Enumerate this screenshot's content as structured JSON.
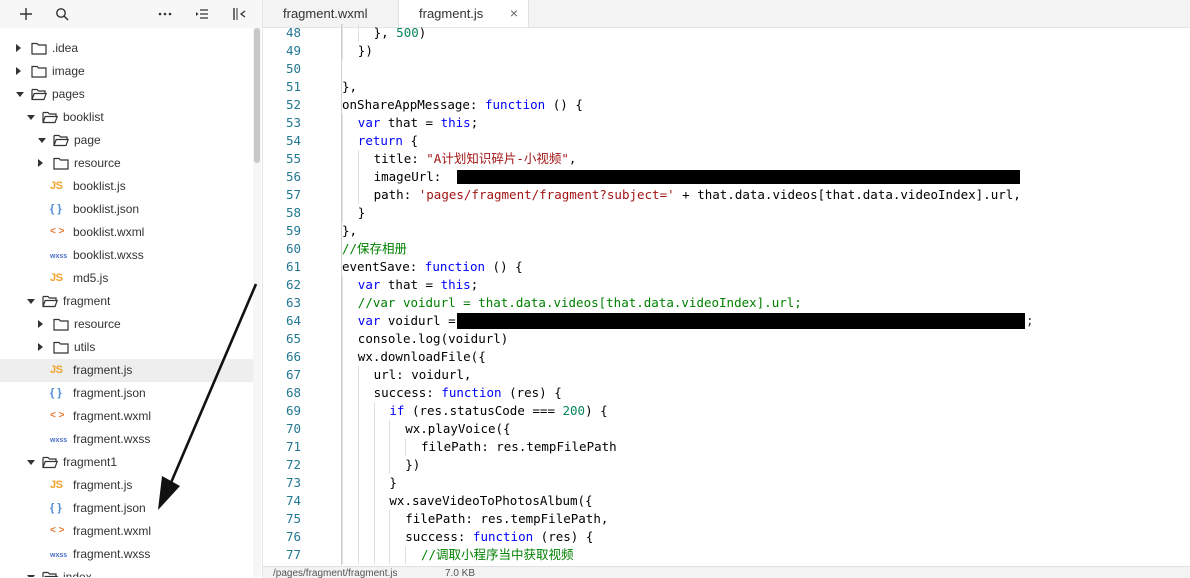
{
  "explorer": {
    "toolbar": {
      "icons": [
        "plus-icon",
        "search-icon",
        "more-icon",
        "outdent-icon",
        "collapse-icon"
      ]
    },
    "tree": [
      {
        "label": ".idea",
        "kind": "folder",
        "depth": 0,
        "expanded": false
      },
      {
        "label": "image",
        "kind": "folder",
        "depth": 0,
        "expanded": false
      },
      {
        "label": "pages",
        "kind": "folder",
        "depth": 0,
        "expanded": true
      },
      {
        "label": "booklist",
        "kind": "folder",
        "depth": 1,
        "expanded": true
      },
      {
        "label": "page",
        "kind": "folder",
        "depth": 2,
        "expanded": true
      },
      {
        "label": "resource",
        "kind": "folder",
        "depth": 2,
        "expanded": false
      },
      {
        "label": "booklist.js",
        "kind": "js",
        "depth": 2
      },
      {
        "label": "booklist.json",
        "kind": "json",
        "depth": 2
      },
      {
        "label": "booklist.wxml",
        "kind": "wxml",
        "depth": 2
      },
      {
        "label": "booklist.wxss",
        "kind": "wxss",
        "depth": 2
      },
      {
        "label": "md5.js",
        "kind": "js",
        "depth": 2
      },
      {
        "label": "fragment",
        "kind": "folder",
        "depth": 1,
        "expanded": true
      },
      {
        "label": "resource",
        "kind": "folder",
        "depth": 2,
        "expanded": false
      },
      {
        "label": "utils",
        "kind": "folder",
        "depth": 2,
        "expanded": false
      },
      {
        "label": "fragment.js",
        "kind": "js",
        "depth": 2,
        "selected": true
      },
      {
        "label": "fragment.json",
        "kind": "json",
        "depth": 2
      },
      {
        "label": "fragment.wxml",
        "kind": "wxml",
        "depth": 2
      },
      {
        "label": "fragment.wxss",
        "kind": "wxss",
        "depth": 2
      },
      {
        "label": "fragment1",
        "kind": "folder",
        "depth": 1,
        "expanded": true
      },
      {
        "label": "fragment.js",
        "kind": "js",
        "depth": 2
      },
      {
        "label": "fragment.json",
        "kind": "json",
        "depth": 2
      },
      {
        "label": "fragment.wxml",
        "kind": "wxml",
        "depth": 2
      },
      {
        "label": "fragment.wxss",
        "kind": "wxss",
        "depth": 2
      },
      {
        "label": "index",
        "kind": "folder",
        "depth": 1,
        "expanded": true
      }
    ],
    "type_badges": {
      "js": "JS",
      "json": "{ }",
      "wxml": "< >",
      "wxss": "wxss"
    }
  },
  "editor": {
    "tabs": [
      {
        "label": "fragment.wxml",
        "active": false
      },
      {
        "label": "fragment.js",
        "active": true,
        "close": "×"
      }
    ],
    "lines": [
      {
        "n": "48",
        "indent": 2,
        "tokens": [
          [
            "p",
            "}, "
          ],
          [
            "num",
            "500"
          ],
          [
            "p",
            ")"
          ]
        ]
      },
      {
        "n": "49",
        "indent": 1,
        "tokens": [
          [
            "p",
            "})"
          ]
        ]
      },
      {
        "n": "50",
        "indent": 0,
        "tokens": []
      },
      {
        "n": "51",
        "indent": 0,
        "tokens": [
          [
            "p",
            "},"
          ]
        ]
      },
      {
        "n": "52",
        "indent": 0,
        "tokens": [
          [
            "p",
            "onShareAppMessage: "
          ],
          [
            "kw",
            "function"
          ],
          [
            "p",
            " () {"
          ]
        ]
      },
      {
        "n": "53",
        "indent": 1,
        "tokens": [
          [
            "kw",
            "var"
          ],
          [
            "p",
            " that = "
          ],
          [
            "kw",
            "this"
          ],
          [
            "p",
            ";"
          ]
        ]
      },
      {
        "n": "54",
        "indent": 1,
        "tokens": [
          [
            "kw",
            "return"
          ],
          [
            "p",
            " {"
          ]
        ]
      },
      {
        "n": "55",
        "indent": 2,
        "tokens": [
          [
            "p",
            "title: "
          ],
          [
            "str",
            "\"A计划知识碎片-小视频\""
          ],
          [
            "p",
            ","
          ]
        ]
      },
      {
        "n": "56",
        "indent": 2,
        "tokens": [
          [
            "p",
            "imageUrl:"
          ]
        ]
      },
      {
        "n": "57",
        "indent": 2,
        "tokens": [
          [
            "p",
            "path: "
          ],
          [
            "str",
            "'pages/fragment/fragment?subject='"
          ],
          [
            "p",
            " + that.data.videos[that.data.videoIndex].url,"
          ]
        ]
      },
      {
        "n": "58",
        "indent": 1,
        "tokens": [
          [
            "p",
            "}"
          ]
        ]
      },
      {
        "n": "59",
        "indent": 0,
        "tokens": [
          [
            "p",
            "},"
          ]
        ]
      },
      {
        "n": "60",
        "indent": 0,
        "tokens": [
          [
            "cm",
            "//保存相册"
          ]
        ]
      },
      {
        "n": "61",
        "indent": 0,
        "tokens": [
          [
            "p",
            "eventSave: "
          ],
          [
            "kw",
            "function"
          ],
          [
            "p",
            " () {"
          ]
        ]
      },
      {
        "n": "62",
        "indent": 1,
        "tokens": [
          [
            "kw",
            "var"
          ],
          [
            "p",
            " that = "
          ],
          [
            "kw",
            "this"
          ],
          [
            "p",
            ";"
          ]
        ]
      },
      {
        "n": "63",
        "indent": 1,
        "tokens": [
          [
            "cm",
            "//var voidurl = that.data.videos[that.data.videoIndex].url;"
          ]
        ]
      },
      {
        "n": "64",
        "indent": 1,
        "tokens": [
          [
            "kw",
            "var"
          ],
          [
            "p",
            " voidurl ="
          ]
        ]
      },
      {
        "n": "65",
        "indent": 1,
        "tokens": [
          [
            "p",
            "console.log(voidurl)"
          ]
        ]
      },
      {
        "n": "66",
        "indent": 1,
        "tokens": [
          [
            "p",
            "wx.downloadFile({"
          ]
        ]
      },
      {
        "n": "67",
        "indent": 2,
        "tokens": [
          [
            "p",
            "url: voidurl,"
          ]
        ]
      },
      {
        "n": "68",
        "indent": 2,
        "tokens": [
          [
            "p",
            "success: "
          ],
          [
            "kw",
            "function"
          ],
          [
            "p",
            " (res) {"
          ]
        ]
      },
      {
        "n": "69",
        "indent": 3,
        "tokens": [
          [
            "kw",
            "if"
          ],
          [
            "p",
            " (res.statusCode === "
          ],
          [
            "num",
            "200"
          ],
          [
            "p",
            ") {"
          ]
        ]
      },
      {
        "n": "70",
        "indent": 4,
        "tokens": [
          [
            "p",
            "wx.playVoice({"
          ]
        ]
      },
      {
        "n": "71",
        "indent": 5,
        "tokens": [
          [
            "p",
            "filePath: res.tempFilePath"
          ]
        ]
      },
      {
        "n": "72",
        "indent": 4,
        "tokens": [
          [
            "p",
            "})"
          ]
        ]
      },
      {
        "n": "73",
        "indent": 3,
        "tokens": [
          [
            "p",
            "}"
          ]
        ]
      },
      {
        "n": "74",
        "indent": 3,
        "tokens": [
          [
            "p",
            "wx.saveVideoToPhotosAlbum({"
          ]
        ]
      },
      {
        "n": "75",
        "indent": 4,
        "tokens": [
          [
            "p",
            "filePath: res.tempFilePath,"
          ]
        ]
      },
      {
        "n": "76",
        "indent": 4,
        "tokens": [
          [
            "p",
            "success: "
          ],
          [
            "kw",
            "function"
          ],
          [
            "p",
            " (res) {"
          ]
        ]
      },
      {
        "n": "77",
        "indent": 5,
        "tokens": [
          [
            "cm",
            "//调取小程序当中获取视频"
          ]
        ]
      }
    ],
    "line64_suffix": ";",
    "colors": {
      "keyword": "#0000ff",
      "string": "#a31515",
      "comment": "#008000",
      "number": "#098658",
      "line_number": "#237893"
    }
  },
  "statusbar": {
    "path": "/pages/fragment/fragment.js",
    "size": "7.0 KB"
  }
}
